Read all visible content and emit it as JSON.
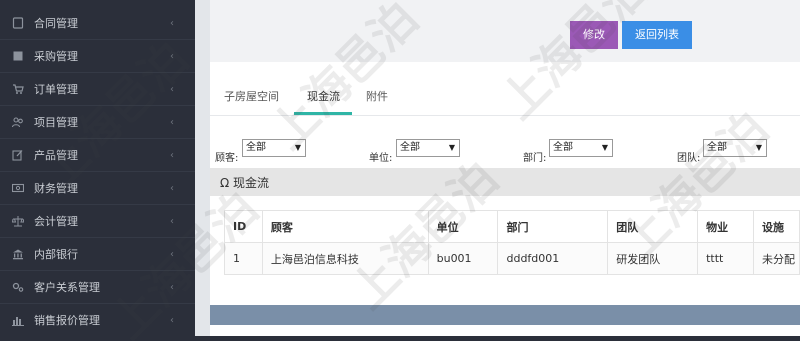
{
  "sidebar": {
    "items": [
      {
        "label": "合同管理",
        "icon": "document-icon"
      },
      {
        "label": "采购管理",
        "icon": "book-icon"
      },
      {
        "label": "订单管理",
        "icon": "cart-icon"
      },
      {
        "label": "项目管理",
        "icon": "users-icon"
      },
      {
        "label": "产品管理",
        "icon": "edit-icon"
      },
      {
        "label": "财务管理",
        "icon": "money-icon"
      },
      {
        "label": "会计管理",
        "icon": "scale-icon"
      },
      {
        "label": "内部银行",
        "icon": "bank-icon"
      },
      {
        "label": "客户关系管理",
        "icon": "gears-icon"
      },
      {
        "label": "销售报价管理",
        "icon": "bar-chart-icon"
      }
    ],
    "chevron": "‹"
  },
  "toolbar": {
    "edit_label": "修改",
    "back_label": "返回列表"
  },
  "tabs": [
    {
      "label": "子房屋空间"
    },
    {
      "label": "现金流",
      "active": true
    },
    {
      "label": "附件"
    }
  ],
  "filters": [
    {
      "label": "顾客:",
      "value": "全部"
    },
    {
      "label": "单位:",
      "value": "全部"
    },
    {
      "label": "部门:",
      "value": "全部"
    },
    {
      "label": "团队:",
      "value": "全部"
    }
  ],
  "section": {
    "title": "现金流",
    "icon_glyph": "Ω"
  },
  "table": {
    "columns": [
      "ID",
      "顾客",
      "单位",
      "部门",
      "团队",
      "物业",
      "设施"
    ],
    "rows": [
      [
        "1",
        "上海邑泊信息科技",
        "bu001",
        "dddfd001",
        "研发团队",
        "tttt",
        "未分配"
      ]
    ]
  },
  "watermark": "上海邑泊",
  "colors": {
    "sidebar_bg": "#2b2f3a",
    "edit_button": "#9b59b6",
    "back_button": "#3a8ee6",
    "tab_underline": "#2fb5a6"
  }
}
